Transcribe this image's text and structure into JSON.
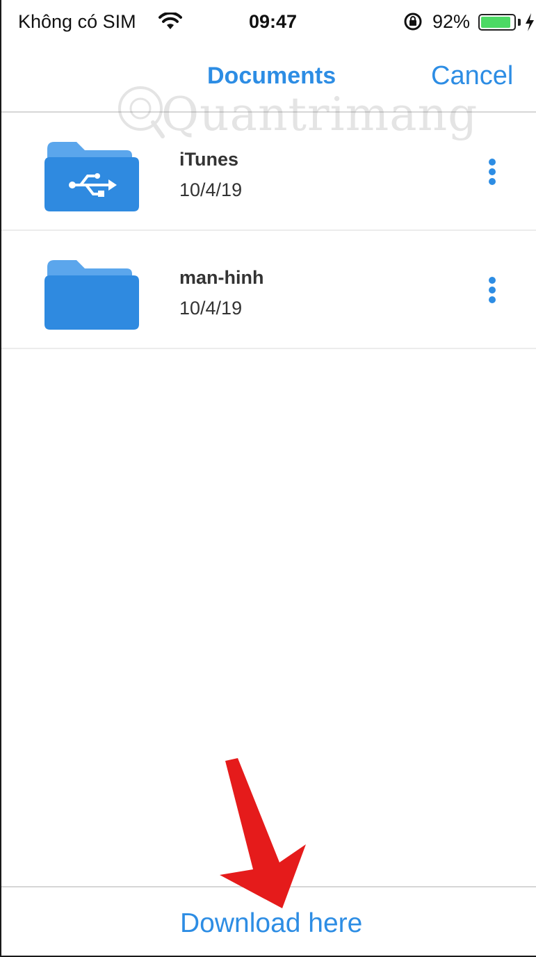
{
  "status_bar": {
    "carrier": "Không có SIM",
    "time": "09:47",
    "battery_percent": "92%",
    "battery_level": 0.92,
    "icons": [
      "wifi-icon",
      "rotation-lock-icon",
      "battery-icon",
      "charging-icon"
    ]
  },
  "nav": {
    "title": "Documents",
    "cancel_label": "Cancel"
  },
  "watermark": {
    "text": "Quantrimang"
  },
  "files": [
    {
      "name": "iTunes",
      "date": "10/4/19",
      "icon": "usb-folder-icon"
    },
    {
      "name": "man-hinh",
      "date": "10/4/19",
      "icon": "folder-icon"
    }
  ],
  "bottom": {
    "download_label": "Download here"
  },
  "colors": {
    "accent": "#2d8de4",
    "folder_dark": "#2f8ae0",
    "folder_light": "#5ba6ec",
    "arrow": "#e51b1b",
    "battery_fill": "#4cd964"
  }
}
